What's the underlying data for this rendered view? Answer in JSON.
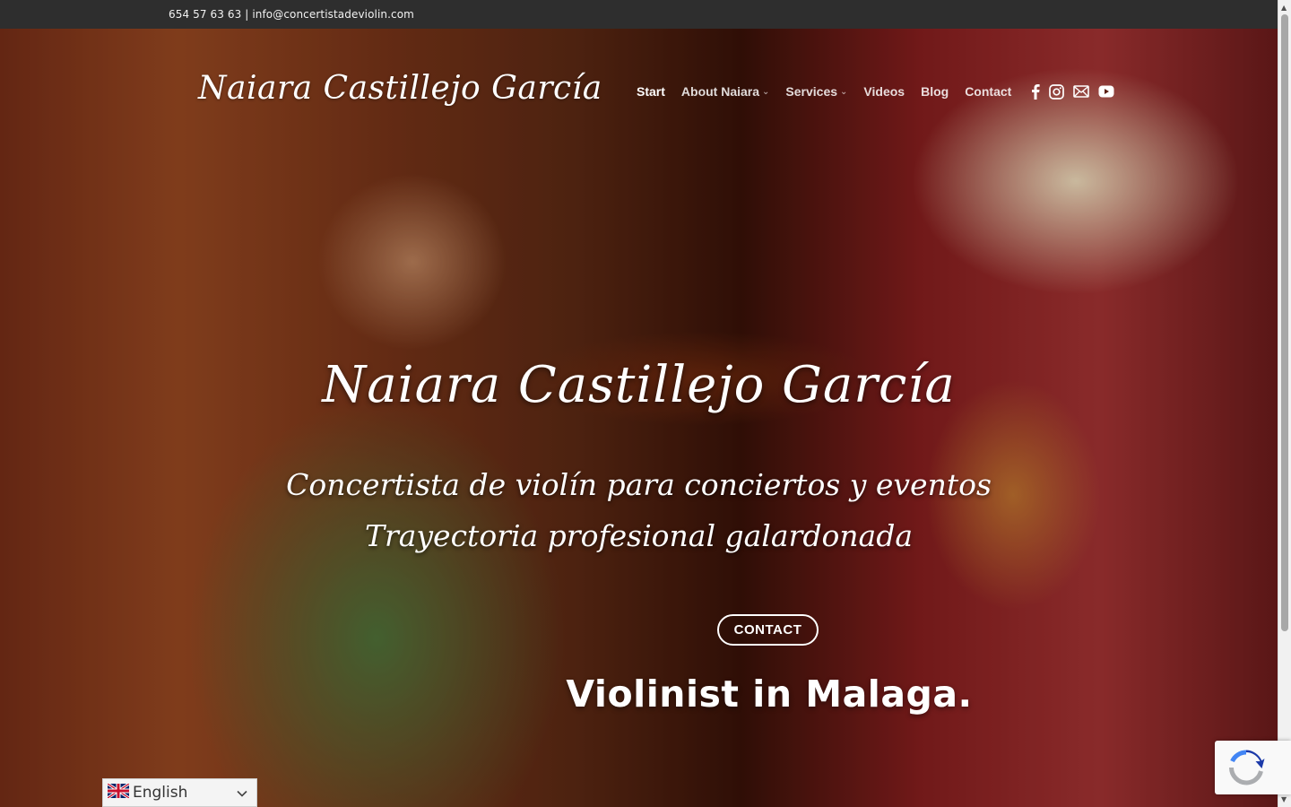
{
  "topbar": {
    "contact_line": "654 57 63 63 | info@concertistadeviolin.com"
  },
  "header": {
    "logo": "Naiara Castillejo García",
    "nav": [
      {
        "label": "Start",
        "active": true,
        "has_dropdown": false
      },
      {
        "label": "About Naiara",
        "active": false,
        "has_dropdown": true
      },
      {
        "label": "Services",
        "active": false,
        "has_dropdown": true
      },
      {
        "label": "Videos",
        "active": false,
        "has_dropdown": false
      },
      {
        "label": "Blog",
        "active": false,
        "has_dropdown": false
      },
      {
        "label": "Contact",
        "active": false,
        "has_dropdown": false
      }
    ],
    "social_icons": [
      "facebook-icon",
      "instagram-icon",
      "email-icon",
      "youtube-icon"
    ]
  },
  "hero": {
    "title": "Naiara Castillejo García",
    "subtitle_line1": "Concertista de violín para conciertos y eventos",
    "subtitle_line2": "Trayectoria profesional galardonada",
    "button_label": "CONTACT",
    "tagline": "Violinist in Malaga."
  },
  "language_selector": {
    "selected": "English",
    "flag": "uk-flag-icon"
  },
  "colors": {
    "topbar_bg": "#2e2e2e",
    "text": "#ffffff",
    "hero_dark": "#3a1208"
  }
}
